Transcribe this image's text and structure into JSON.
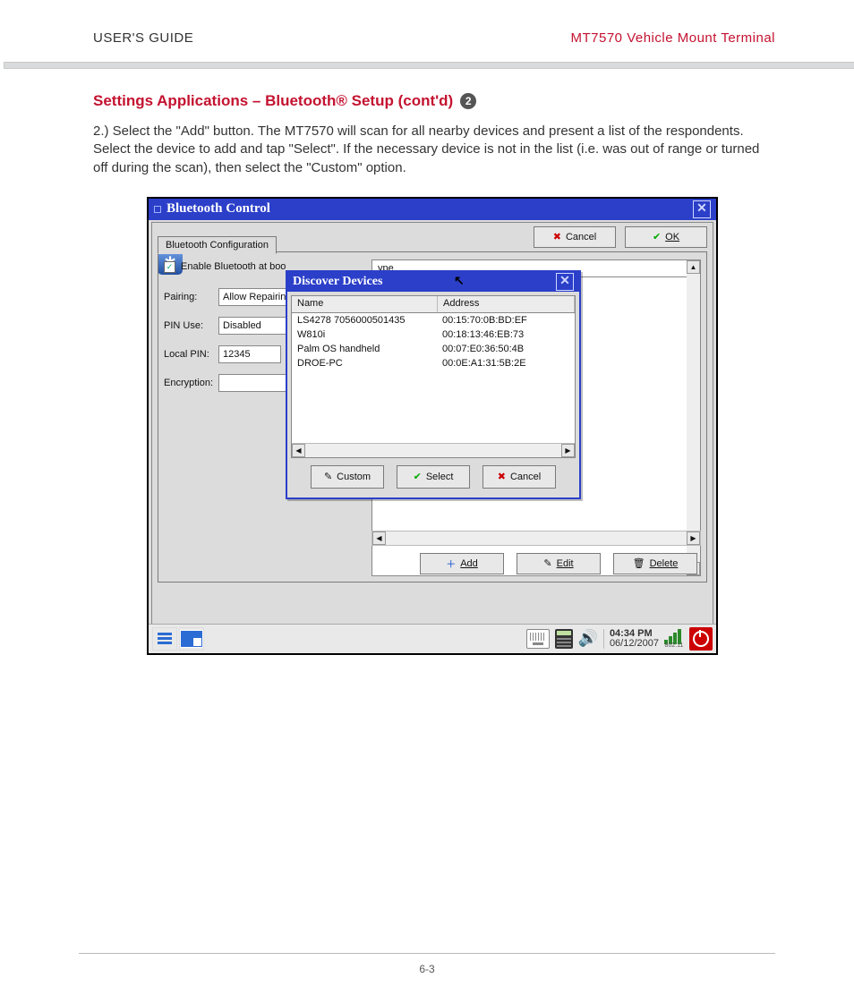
{
  "header": {
    "left": "USER'S GUIDE",
    "right": "MT7570 Vehicle Mount Terminal"
  },
  "section": {
    "title": "Settings Applications – Bluetooth® Setup (cont'd)",
    "badge": "2"
  },
  "body": "2.)  Select the \"Add\" button.  The MT7570 will scan for all nearby devices and present a list of the respondents.  Select the device to add and tap \"Select\".  If the necessary device is not in the list (i.e. was out of range or turned off during the scan), then select the \"Custom\" option.",
  "bluetooth_window": {
    "title": "Bluetooth Control",
    "close": "✕",
    "top_buttons": {
      "cancel": {
        "icon": "✖",
        "label": "Cancel"
      },
      "ok": {
        "icon": "✔",
        "label": "OK"
      }
    },
    "tab_label": "Bluetooth Configuration",
    "enable_checkbox": {
      "checked": true,
      "label": "Enable Bluetooth at boo"
    },
    "rows": {
      "pairing": {
        "label": "Pairing:",
        "value": "Allow Repairing"
      },
      "pin_use": {
        "label": "PIN Use:",
        "value": "Disabled"
      },
      "local_pin": {
        "label": "Local PIN:",
        "value": "12345"
      },
      "encryption": {
        "label": "Encryption:",
        "value": ""
      }
    },
    "right_col": {
      "header_col": "ype"
    },
    "bottom_buttons": {
      "add": {
        "icon": "＋",
        "label": "Add"
      },
      "edit": {
        "icon": "✎",
        "label": "Edit"
      },
      "delete": {
        "icon": "🗑",
        "label": "Delete"
      }
    }
  },
  "discover_modal": {
    "title": "Discover Devices",
    "close": "✕",
    "columns": {
      "name": "Name",
      "address": "Address"
    },
    "rows": [
      {
        "name": "LS4278 7056000501435",
        "address": "00:15:70:0B:BD:EF"
      },
      {
        "name": "W810i",
        "address": "00:18:13:46:EB:73"
      },
      {
        "name": "Palm OS handheld",
        "address": "00:07:E0:36:50:4B"
      },
      {
        "name": "DROE-PC",
        "address": "00:0E:A1:31:5B:2E"
      }
    ],
    "buttons": {
      "custom": {
        "icon": "✎",
        "label": "Custom"
      },
      "select": {
        "icon": "✔",
        "label": "Select"
      },
      "cancel": {
        "icon": "✖",
        "label": "Cancel"
      }
    }
  },
  "taskbar": {
    "time": "04:34 PM",
    "date": "06/12/2007",
    "wifi_std": "802.11"
  },
  "footer": {
    "page": "6-3"
  },
  "icons": {
    "bt_glyph": "∗"
  }
}
